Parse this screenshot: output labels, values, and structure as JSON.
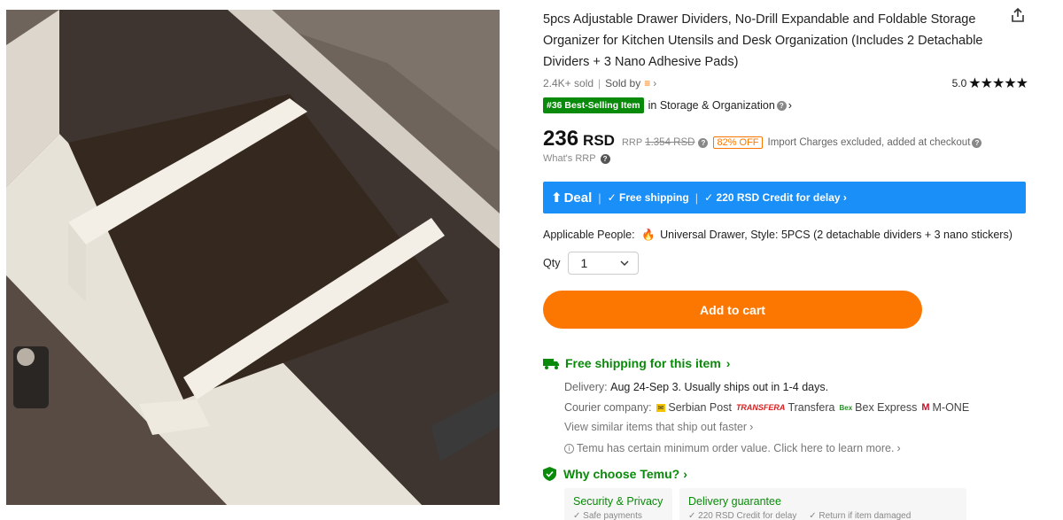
{
  "product": {
    "title": "5pcs Adjustable Drawer Dividers, No-Drill Expandable and Foldable Storage Organizer for Kitchen Utensils and Desk Organization (Includes 2 Detachable Dividers + 3 Nano Adhesive Pads)",
    "sold": "2.4K+ sold",
    "sold_by": "Sold by",
    "rating": "5.0",
    "stars": "★★★★★",
    "rating_value": 5,
    "badge": "#36 Best-Selling Item",
    "category": "in Storage & Organization",
    "price": "236",
    "currency": "RSD",
    "rrp_label": "RRP",
    "rrp_value": "1.354 RSD",
    "discount": "82% OFF",
    "import_note": "Import Charges excluded, added at checkout",
    "whats_rrp": "What's RRP"
  },
  "deal_bar": {
    "deal": "Deal",
    "free_shipping": "Free shipping",
    "credit": "220 RSD Credit for delay"
  },
  "options": {
    "applicable_label": "Applicable People:",
    "applicable_value": "Universal Drawer,",
    "style_label": "Style:",
    "style_value": "5PCS (2 detachable dividers + 3 nano stickers)",
    "qty_label": "Qty",
    "qty_value": "1"
  },
  "cart": {
    "label": "Add to cart"
  },
  "shipping": {
    "heading": "Free shipping for this item",
    "delivery_label": "Delivery:",
    "delivery_value": "Aug 24-Sep 3. Usually ships out in 1-4 days.",
    "courier_label": "Courier company:",
    "couriers": [
      "Serbian Post",
      "Transfera",
      "Bex Express",
      "M-ONE"
    ],
    "transfera_logo": "TRANSFERA",
    "bex_logo": "Bex",
    "similar": "View similar items that ship out faster",
    "min_order": "Temu has certain minimum order value. Click here to learn more."
  },
  "why": {
    "heading": "Why choose Temu?",
    "cards": [
      {
        "title": "Security & Privacy",
        "sub": "✓ Safe payments"
      },
      {
        "title": "Delivery guarantee",
        "sub": "✓ 220 RSD Credit for delay     ✓ Return if item damaged"
      }
    ]
  },
  "colors": {
    "accent": "#fb7701",
    "deal_blue": "#1a8ff7",
    "green": "#0a8a0a"
  },
  "icons": [
    "share-icon",
    "question-icon",
    "flame-icon",
    "truck-icon",
    "shield-check-icon",
    "chevron-down-icon",
    "chevron-right-icon",
    "info-icon"
  ]
}
